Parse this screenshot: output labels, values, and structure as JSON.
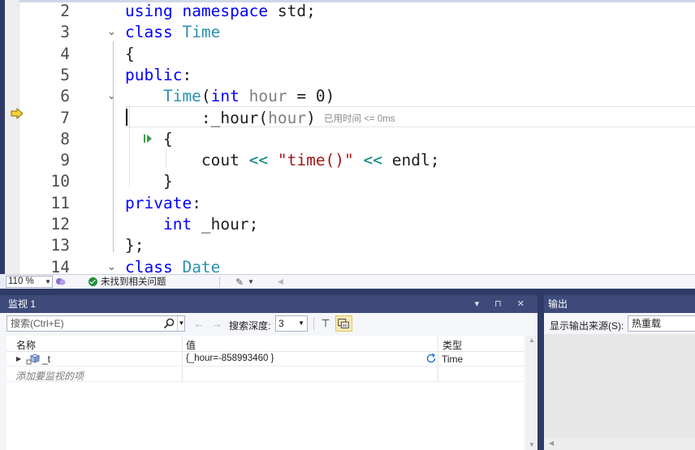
{
  "editor": {
    "lines": [
      {
        "num": "2",
        "fold": "",
        "tokens": [
          {
            "t": "using ",
            "c": "kw"
          },
          {
            "t": "namespace ",
            "c": "kw"
          },
          {
            "t": "std;",
            "c": "plain"
          }
        ]
      },
      {
        "num": "3",
        "fold": "⌄",
        "tokens": [
          {
            "t": "class ",
            "c": "kw"
          },
          {
            "t": "Time",
            "c": "type"
          }
        ]
      },
      {
        "num": "4",
        "fold": "",
        "tokens": [
          {
            "t": "{",
            "c": "plain"
          }
        ]
      },
      {
        "num": "5",
        "fold": "",
        "tokens": [
          {
            "t": "public",
            "c": "kw"
          },
          {
            "t": ":",
            "c": "plain"
          }
        ]
      },
      {
        "num": "6",
        "fold": "⌄",
        "tokens": [
          {
            "t": "    Time",
            "c": "type"
          },
          {
            "t": "(",
            "c": "plain"
          },
          {
            "t": "int ",
            "c": "kw"
          },
          {
            "t": "hour",
            "c": "param"
          },
          {
            "t": " = 0)",
            "c": "plain"
          }
        ]
      },
      {
        "num": "7",
        "fold": "",
        "tokens": [
          {
            "t": "        :_hour(",
            "c": "plain"
          },
          {
            "t": "hour",
            "c": "param"
          },
          {
            "t": ")",
            "c": "plain"
          }
        ]
      },
      {
        "num": "8",
        "fold": "",
        "tokens": [
          {
            "t": "    {",
            "c": "plain"
          }
        ]
      },
      {
        "num": "9",
        "fold": "",
        "tokens": [
          {
            "t": "        cout ",
            "c": "plain"
          },
          {
            "t": "<< ",
            "c": "op"
          },
          {
            "t": "\"time()\"",
            "c": "str"
          },
          {
            "t": " << ",
            "c": "op"
          },
          {
            "t": "endl;",
            "c": "plain"
          }
        ]
      },
      {
        "num": "10",
        "fold": "",
        "tokens": [
          {
            "t": "    }",
            "c": "plain"
          }
        ]
      },
      {
        "num": "11",
        "fold": "",
        "tokens": [
          {
            "t": "private",
            "c": "kw"
          },
          {
            "t": ":",
            "c": "plain"
          }
        ]
      },
      {
        "num": "12",
        "fold": "",
        "tokens": [
          {
            "t": "    int ",
            "c": "kw"
          },
          {
            "t": "_hour;",
            "c": "plain"
          }
        ]
      },
      {
        "num": "13",
        "fold": "",
        "tokens": [
          {
            "t": "};",
            "c": "plain"
          }
        ]
      },
      {
        "num": "14",
        "fold": "⌄",
        "tokens": [
          {
            "t": "class ",
            "c": "kw"
          },
          {
            "t": "Date",
            "c": "type"
          }
        ]
      }
    ],
    "perf_tip": "已用时间 <= 0ms",
    "current_line": "7"
  },
  "status": {
    "zoom": "110 %",
    "issues": "未找到相关问题"
  },
  "watch": {
    "title": "监视 1",
    "title_buttons": "▾ ⊓ ✕",
    "search_placeholder": "搜索(Ctrl+E)",
    "depth_label": "搜索深度:",
    "depth_value": "3",
    "columns": {
      "name": "名称",
      "value": "值",
      "type": "类型"
    },
    "rows": [
      {
        "name": "_t",
        "value": "{_hour=-858993460 }",
        "type": "Time"
      }
    ],
    "add_item": "添加要监视的项"
  },
  "output": {
    "title": "输出",
    "source_label": "显示输出来源(S):",
    "source_value": "热重载"
  },
  "colors": {
    "accent": "#3d4a7a",
    "keyword": "#0000ff",
    "type": "#2b91af",
    "string": "#a31515"
  }
}
